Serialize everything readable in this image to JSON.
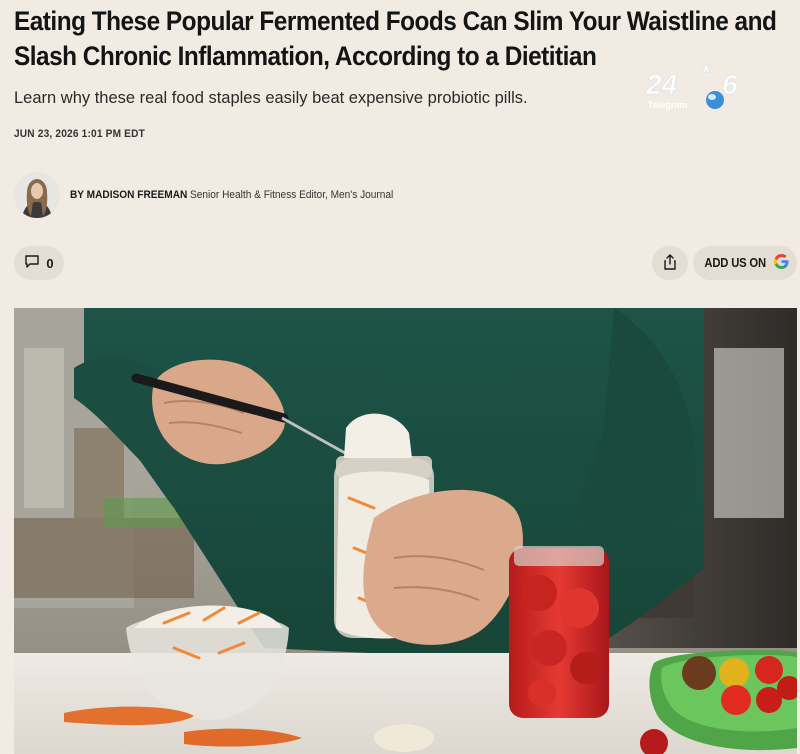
{
  "article": {
    "headline": "Eating These Popular Fermented Foods Can Slim Your Waistline and Slash Chronic Inflammation, According to a Dietitian",
    "dek": "Learn why these real food staples easily beat expensive probiotic pills.",
    "date": "JUN 23, 2026 1:01 PM EDT"
  },
  "byline": {
    "prefix": "BY MADISON FREEMAN",
    "title": "Senior Health & Fitness Editor, Men's Journal"
  },
  "actions": {
    "comment_count": "0",
    "add_us_label": "ADD US ON",
    "google_glyph": "G"
  },
  "watermark": {
    "main": "24",
    "star": "*",
    "num": "6",
    "sub": "Telegram"
  },
  "icons": {
    "comment": "comment-icon",
    "share": "share-icon",
    "google": "google-icon"
  },
  "colors": {
    "background": "#f1ebe3",
    "pill": "#e4ddd4",
    "text": "#141414",
    "sweater": "#1f5a4c"
  }
}
